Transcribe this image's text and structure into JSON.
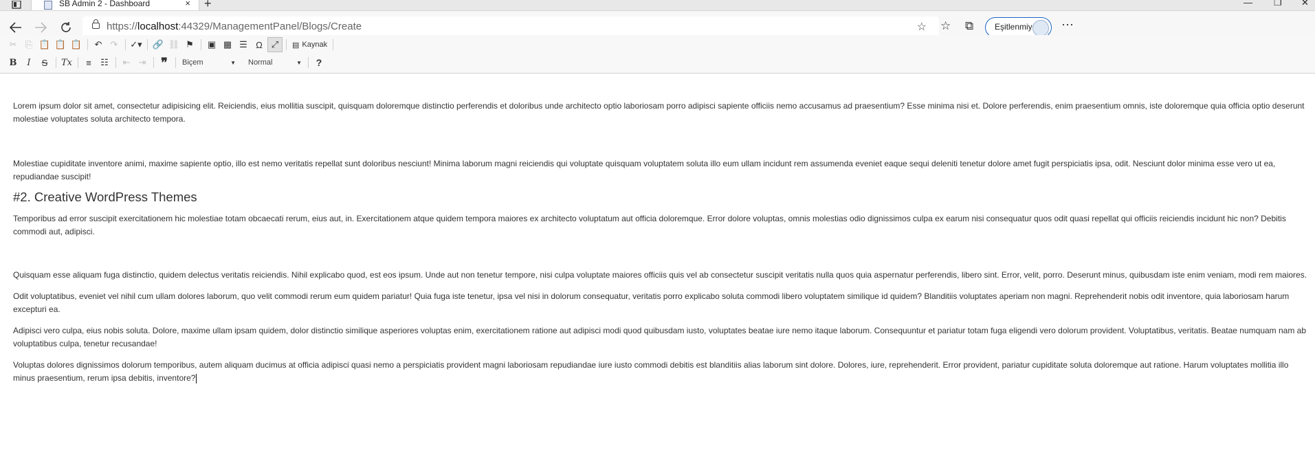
{
  "browser": {
    "tab_title": "SB Admin 2 - Dashboard",
    "tab_close_glyph": "×",
    "new_tab_glyph": "+",
    "url_scheme": "https://",
    "url_host": "localhost",
    "url_path": ":44329/ManagementPanel/Blogs/Create",
    "sync_label": "Eşitlenmiyor",
    "more_glyph": "⋯",
    "icons": [
      "back-icon",
      "forward-icon",
      "refresh-icon",
      "lock-icon",
      "add-favorite-icon",
      "favorites-icon",
      "collections-icon",
      "profile-avatar-icon",
      "more-icon"
    ]
  },
  "editor": {
    "source_label": "Kaynak",
    "format_combo": "Biçem",
    "paragraph_combo": "Normal",
    "help_glyph": "?",
    "colors": {
      "toolbar_bg": "#f8f8f8",
      "toolbar_border": "#d1d1d1",
      "text": "#333333"
    }
  },
  "content": {
    "p1": "Lorem ipsum dolor sit amet, consectetur adipisicing elit. Reiciendis, eius mollitia suscipit, quisquam doloremque distinctio perferendis et doloribus unde architecto optio laboriosam porro adipisci sapiente officiis nemo accusamus ad praesentium? Esse minima nisi et. Dolore perferendis, enim praesentium omnis, iste doloremque quia officia optio deserunt molestiae voluptates soluta architecto tempora.",
    "p2": "Molestiae cupiditate inventore animi, maxime sapiente optio, illo est nemo veritatis repellat sunt doloribus nesciunt! Minima laborum magni reiciendis qui voluptate quisquam voluptatem soluta illo eum ullam incidunt rem assumenda eveniet eaque sequi deleniti tenetur dolore amet fugit perspiciatis ipsa, odit. Nesciunt dolor minima esse vero ut ea, repudiandae suscipit!",
    "heading": "#2. Creative WordPress Themes",
    "p3": "Temporibus ad error suscipit exercitationem hic molestiae totam obcaecati rerum, eius aut, in. Exercitationem atque quidem tempora maiores ex architecto voluptatum aut officia doloremque. Error dolore voluptas, omnis molestias odio dignissimos culpa ex earum nisi consequatur quos odit quasi repellat qui officiis reiciendis incidunt hic non? Debitis commodi aut, adipisci.",
    "p4": "Quisquam esse aliquam fuga distinctio, quidem delectus veritatis reiciendis. Nihil explicabo quod, est eos ipsum. Unde aut non tenetur tempore, nisi culpa voluptate maiores officiis quis vel ab consectetur suscipit veritatis nulla quos quia aspernatur perferendis, libero sint. Error, velit, porro. Deserunt minus, quibusdam iste enim veniam, modi rem maiores.",
    "p5": "Odit voluptatibus, eveniet vel nihil cum ullam dolores laborum, quo velit commodi rerum eum quidem pariatur! Quia fuga iste tenetur, ipsa vel nisi in dolorum consequatur, veritatis porro explicabo soluta commodi libero voluptatem similique id quidem? Blanditiis voluptates aperiam non magni. Reprehenderit nobis odit inventore, quia laboriosam harum excepturi ea.",
    "p6": "Adipisci vero culpa, eius nobis soluta. Dolore, maxime ullam ipsam quidem, dolor distinctio similique asperiores voluptas enim, exercitationem ratione aut adipisci modi quod quibusdam iusto, voluptates beatae iure nemo itaque laborum. Consequuntur et pariatur totam fuga eligendi vero dolorum provident. Voluptatibus, veritatis. Beatae numquam nam ab voluptatibus culpa, tenetur recusandae!",
    "p7": "Voluptas dolores dignissimos dolorum temporibus, autem aliquam ducimus at officia adipisci quasi nemo a perspiciatis provident magni laboriosam repudiandae iure iusto commodi debitis est blanditiis alias laborum sint dolore. Dolores, iure, reprehenderit. Error provident, pariatur cupiditate soluta doloremque aut ratione. Harum voluptates mollitia illo minus praesentium, rerum ipsa debitis, inventore?"
  }
}
